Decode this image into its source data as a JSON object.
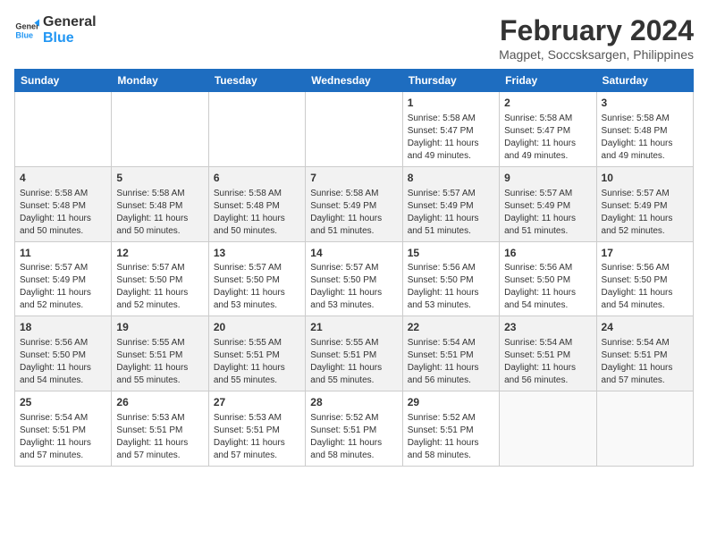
{
  "logo": {
    "line1": "General",
    "line2": "Blue"
  },
  "title": "February 2024",
  "subtitle": "Magpet, Soccsksargen, Philippines",
  "days_of_week": [
    "Sunday",
    "Monday",
    "Tuesday",
    "Wednesday",
    "Thursday",
    "Friday",
    "Saturday"
  ],
  "weeks": [
    [
      {
        "day": "",
        "info": ""
      },
      {
        "day": "",
        "info": ""
      },
      {
        "day": "",
        "info": ""
      },
      {
        "day": "",
        "info": ""
      },
      {
        "day": "1",
        "info": "Sunrise: 5:58 AM\nSunset: 5:47 PM\nDaylight: 11 hours and 49 minutes."
      },
      {
        "day": "2",
        "info": "Sunrise: 5:58 AM\nSunset: 5:47 PM\nDaylight: 11 hours and 49 minutes."
      },
      {
        "day": "3",
        "info": "Sunrise: 5:58 AM\nSunset: 5:48 PM\nDaylight: 11 hours and 49 minutes."
      }
    ],
    [
      {
        "day": "4",
        "info": "Sunrise: 5:58 AM\nSunset: 5:48 PM\nDaylight: 11 hours and 50 minutes."
      },
      {
        "day": "5",
        "info": "Sunrise: 5:58 AM\nSunset: 5:48 PM\nDaylight: 11 hours and 50 minutes."
      },
      {
        "day": "6",
        "info": "Sunrise: 5:58 AM\nSunset: 5:48 PM\nDaylight: 11 hours and 50 minutes."
      },
      {
        "day": "7",
        "info": "Sunrise: 5:58 AM\nSunset: 5:49 PM\nDaylight: 11 hours and 51 minutes."
      },
      {
        "day": "8",
        "info": "Sunrise: 5:57 AM\nSunset: 5:49 PM\nDaylight: 11 hours and 51 minutes."
      },
      {
        "day": "9",
        "info": "Sunrise: 5:57 AM\nSunset: 5:49 PM\nDaylight: 11 hours and 51 minutes."
      },
      {
        "day": "10",
        "info": "Sunrise: 5:57 AM\nSunset: 5:49 PM\nDaylight: 11 hours and 52 minutes."
      }
    ],
    [
      {
        "day": "11",
        "info": "Sunrise: 5:57 AM\nSunset: 5:49 PM\nDaylight: 11 hours and 52 minutes."
      },
      {
        "day": "12",
        "info": "Sunrise: 5:57 AM\nSunset: 5:50 PM\nDaylight: 11 hours and 52 minutes."
      },
      {
        "day": "13",
        "info": "Sunrise: 5:57 AM\nSunset: 5:50 PM\nDaylight: 11 hours and 53 minutes."
      },
      {
        "day": "14",
        "info": "Sunrise: 5:57 AM\nSunset: 5:50 PM\nDaylight: 11 hours and 53 minutes."
      },
      {
        "day": "15",
        "info": "Sunrise: 5:56 AM\nSunset: 5:50 PM\nDaylight: 11 hours and 53 minutes."
      },
      {
        "day": "16",
        "info": "Sunrise: 5:56 AM\nSunset: 5:50 PM\nDaylight: 11 hours and 54 minutes."
      },
      {
        "day": "17",
        "info": "Sunrise: 5:56 AM\nSunset: 5:50 PM\nDaylight: 11 hours and 54 minutes."
      }
    ],
    [
      {
        "day": "18",
        "info": "Sunrise: 5:56 AM\nSunset: 5:50 PM\nDaylight: 11 hours and 54 minutes."
      },
      {
        "day": "19",
        "info": "Sunrise: 5:55 AM\nSunset: 5:51 PM\nDaylight: 11 hours and 55 minutes."
      },
      {
        "day": "20",
        "info": "Sunrise: 5:55 AM\nSunset: 5:51 PM\nDaylight: 11 hours and 55 minutes."
      },
      {
        "day": "21",
        "info": "Sunrise: 5:55 AM\nSunset: 5:51 PM\nDaylight: 11 hours and 55 minutes."
      },
      {
        "day": "22",
        "info": "Sunrise: 5:54 AM\nSunset: 5:51 PM\nDaylight: 11 hours and 56 minutes."
      },
      {
        "day": "23",
        "info": "Sunrise: 5:54 AM\nSunset: 5:51 PM\nDaylight: 11 hours and 56 minutes."
      },
      {
        "day": "24",
        "info": "Sunrise: 5:54 AM\nSunset: 5:51 PM\nDaylight: 11 hours and 57 minutes."
      }
    ],
    [
      {
        "day": "25",
        "info": "Sunrise: 5:54 AM\nSunset: 5:51 PM\nDaylight: 11 hours and 57 minutes."
      },
      {
        "day": "26",
        "info": "Sunrise: 5:53 AM\nSunset: 5:51 PM\nDaylight: 11 hours and 57 minutes."
      },
      {
        "day": "27",
        "info": "Sunrise: 5:53 AM\nSunset: 5:51 PM\nDaylight: 11 hours and 57 minutes."
      },
      {
        "day": "28",
        "info": "Sunrise: 5:52 AM\nSunset: 5:51 PM\nDaylight: 11 hours and 58 minutes."
      },
      {
        "day": "29",
        "info": "Sunrise: 5:52 AM\nSunset: 5:51 PM\nDaylight: 11 hours and 58 minutes."
      },
      {
        "day": "",
        "info": ""
      },
      {
        "day": "",
        "info": ""
      }
    ]
  ]
}
